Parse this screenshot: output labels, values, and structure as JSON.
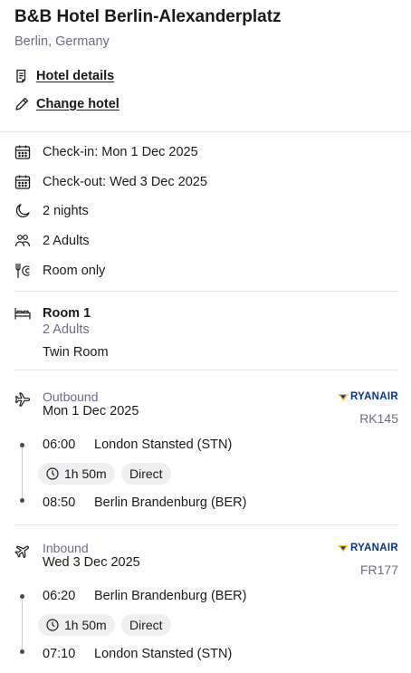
{
  "hotel": {
    "name": "B&B Hotel Berlin-Alexanderplatz",
    "location": "Berlin, Germany"
  },
  "links": {
    "details": "Hotel details",
    "change": "Change hotel"
  },
  "stay": {
    "checkin": "Check-in: Mon 1 Dec 2025",
    "checkout": "Check-out: Wed 3 Dec 2025",
    "nights": "2 nights",
    "guests": "2 Adults",
    "board": "Room only"
  },
  "room": {
    "title": "Room 1",
    "adults": "2 Adults",
    "type": "Twin Room"
  },
  "outbound": {
    "direction": "Outbound",
    "date": "Mon 1 Dec 2025",
    "airline": "RYANAIR",
    "flight_no": "RK145",
    "depart_time": "06:00",
    "depart_airport": "London Stansted (STN)",
    "duration": "1h 50m",
    "stops": "Direct",
    "arrive_time": "08:50",
    "arrive_airport": "Berlin Brandenburg (BER)"
  },
  "inbound": {
    "direction": "Inbound",
    "date": "Wed 3 Dec 2025",
    "airline": "RYANAIR",
    "flight_no": "FR177",
    "depart_time": "06:20",
    "depart_airport": "Berlin Brandenburg (BER)",
    "duration": "1h 50m",
    "stops": "Direct",
    "arrive_time": "07:10",
    "arrive_airport": "London Stansted (STN)"
  },
  "colors": {
    "text": "#1a1a1a",
    "muted": "#6b6b8a",
    "divider": "#e6e6ea",
    "chip": "#efeff2",
    "airline_blue": "#073590",
    "airline_yellow": "#f1c933"
  }
}
